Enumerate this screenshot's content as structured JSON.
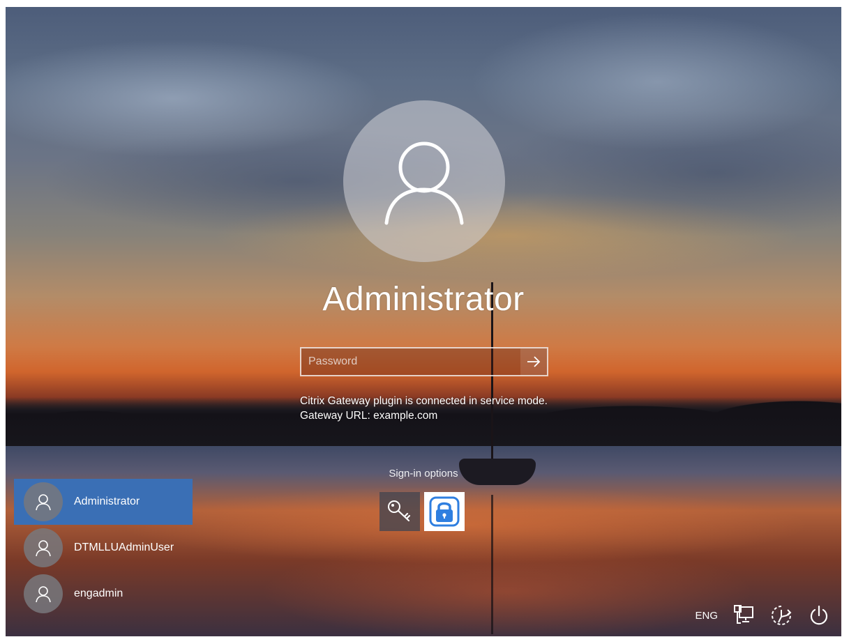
{
  "current_user": {
    "name": "Administrator"
  },
  "password": {
    "placeholder": "Password",
    "value": ""
  },
  "status": {
    "line1": "Citrix Gateway plugin is connected in service mode.",
    "line2": "Gateway URL: example.com"
  },
  "signin_options": {
    "label": "Sign-in options"
  },
  "users": [
    {
      "name": "Administrator",
      "selected": true
    },
    {
      "name": "DTMLLUAdminUser",
      "selected": false
    },
    {
      "name": "engadmin",
      "selected": false
    }
  ],
  "tray": {
    "language": "ENG"
  },
  "icons": {
    "avatar": "user-silhouette-icon",
    "submit": "arrow-right-icon",
    "key": "key-icon",
    "lock": "lock-icon",
    "network": "network-icon",
    "ease_of_access": "ease-of-access-icon",
    "power": "power-icon"
  },
  "colors": {
    "selected_user_bg": "#3a6fb5",
    "lock_icon_blue": "#2f7fe0"
  }
}
